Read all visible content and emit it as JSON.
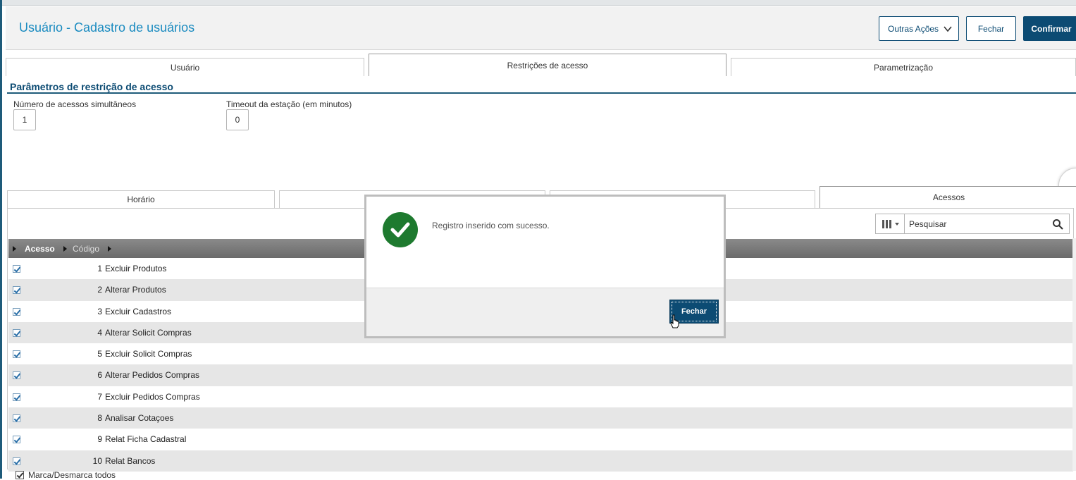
{
  "header": {
    "title": "Usuário - Cadastro de usuários",
    "other_actions_label": "Outras Ações",
    "close_label": "Fechar",
    "confirm_label": "Confirmar"
  },
  "top_tabs": [
    "Usuário",
    "Restrições de acesso",
    "Parametrização"
  ],
  "section": {
    "title": "Parâmetros de restrição de acesso",
    "simultaneous_label": "Número de acessos simultâneos",
    "simultaneous_value": "1",
    "timeout_label": "Timeout da estação (em minutos)",
    "timeout_value": "0"
  },
  "bottom_tabs": [
    "Horário",
    "",
    "",
    "Acessos"
  ],
  "grid": {
    "search_placeholder": "Pesquisar",
    "columns": [
      "Acesso",
      "Código"
    ],
    "rows": [
      {
        "code": "1",
        "desc": "Excluir Produtos",
        "checked": true
      },
      {
        "code": "2",
        "desc": "Alterar Produtos",
        "checked": true
      },
      {
        "code": "3",
        "desc": "Excluir Cadastros",
        "checked": true
      },
      {
        "code": "4",
        "desc": "Alterar Solicit Compras",
        "checked": true
      },
      {
        "code": "5",
        "desc": "Excluir Solicit Compras",
        "checked": true
      },
      {
        "code": "6",
        "desc": "Alterar Pedidos Compras",
        "checked": true
      },
      {
        "code": "7",
        "desc": "Excluir Pedidos Compras",
        "checked": true
      },
      {
        "code": "8",
        "desc": "Analisar Cotaçoes",
        "checked": true
      },
      {
        "code": "9",
        "desc": "Relat Ficha Cadastral",
        "checked": true
      },
      {
        "code": "10",
        "desc": "Relat Bancos",
        "checked": true
      }
    ],
    "toggle_all_label": "Marca/Desmarca todos"
  },
  "modal": {
    "message": "Registro inserido com sucesso.",
    "close_label": "Fechar"
  },
  "colors": {
    "primary": "#0c4b73",
    "title": "#1a8bc0",
    "success": "#1e7a2f"
  }
}
